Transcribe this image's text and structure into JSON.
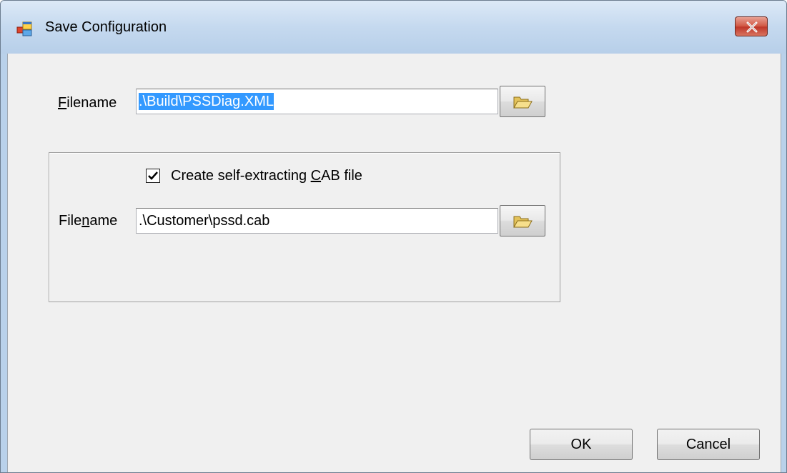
{
  "window": {
    "title": "Save Configuration"
  },
  "config_file": {
    "label_prefix": "",
    "label_mnemonic": "F",
    "label_suffix": "ilename",
    "value": ".\\Build\\PSSDiag.XML",
    "value_selected": true
  },
  "cab": {
    "checkbox_label_prefix": "Create self-extracting ",
    "checkbox_label_mnemonic": "C",
    "checkbox_label_suffix": "AB file",
    "checked": true,
    "filename_label_prefix": "File",
    "filename_label_mnemonic": "n",
    "filename_label_suffix": "ame",
    "value": ".\\Customer\\pssd.cab"
  },
  "buttons": {
    "ok": "OK",
    "cancel": "Cancel"
  },
  "icons": {
    "title": "dialog-window-icon",
    "close": "close-icon",
    "browse": "open-folder-icon",
    "check": "checkmark-icon"
  }
}
